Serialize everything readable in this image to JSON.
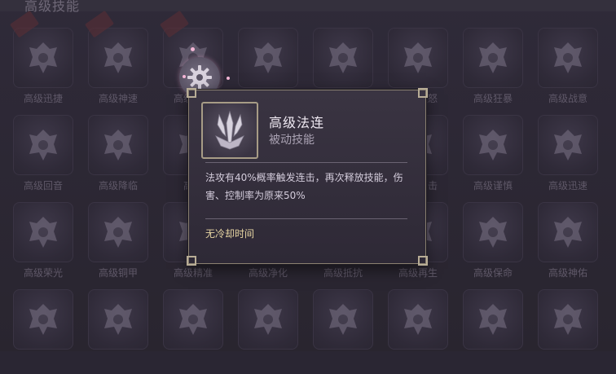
{
  "header": {
    "title": "高级技能"
  },
  "skills": [
    {
      "label": "高级迅捷",
      "icon": "boot-icon"
    },
    {
      "label": "高级神速",
      "icon": "crossed-swords-icon"
    },
    {
      "label": "高级法连",
      "icon": "trident-icon"
    },
    {
      "label": "",
      "icon": "shield-cross-icon"
    },
    {
      "label": "",
      "icon": "axe-icon"
    },
    {
      "label": "高级愤怒",
      "icon": "demon-sword-icon"
    },
    {
      "label": "高级狂暴",
      "icon": "fist-icon"
    },
    {
      "label": "高级战意",
      "icon": "winged-helm-icon"
    },
    {
      "label": "高级回音",
      "icon": "winged-shield-icon"
    },
    {
      "label": "高级降临",
      "icon": "horned-crest-icon"
    },
    {
      "label": "高级",
      "icon": "gem-icon"
    },
    {
      "label": "",
      "icon": "blank-icon"
    },
    {
      "label": "",
      "icon": "blank-icon"
    },
    {
      "label": "高级反击",
      "icon": "claw-icon"
    },
    {
      "label": "高级谨慎",
      "icon": "bow-icon"
    },
    {
      "label": "高级迅速",
      "icon": "ninja-boot-icon"
    },
    {
      "label": "高级荣光",
      "icon": "winged-emblem-icon"
    },
    {
      "label": "高级铜甲",
      "icon": "horned-mask-icon"
    },
    {
      "label": "高级精准",
      "icon": "target-icon"
    },
    {
      "label": "高级净化",
      "icon": "purify-icon"
    },
    {
      "label": "高级抵抗",
      "icon": "resist-icon"
    },
    {
      "label": "高级再生",
      "icon": "leaf-icon"
    },
    {
      "label": "高级保命",
      "icon": "cloud-heart-icon"
    },
    {
      "label": "高级神佑",
      "icon": "winged-cross-icon"
    },
    {
      "label": "",
      "icon": "crossed-blades-icon"
    },
    {
      "label": "",
      "icon": "knight-helm-icon"
    },
    {
      "label": "",
      "icon": "spartan-helm-icon"
    },
    {
      "label": "",
      "icon": "heart-shield-icon"
    },
    {
      "label": "",
      "icon": "hooded-figure-icon"
    },
    {
      "label": "",
      "icon": "armor-icon"
    },
    {
      "label": "",
      "icon": "viking-helm-icon"
    },
    {
      "label": "",
      "icon": "crest-shield-icon"
    }
  ],
  "tooltip": {
    "title": "高级法连",
    "subtitle": "被动技能",
    "description": "法攻有40%概率触发连击，再次释放技能，伤害、控制率为原来50%",
    "cooldown": "无冷却时间",
    "icon": "trident-icon"
  },
  "settings_button": {
    "icon": "gear-icon"
  },
  "colors": {
    "accent_gold": "#e8d6a3",
    "frame": "#8a8070",
    "backdrop": "#2a2633"
  }
}
